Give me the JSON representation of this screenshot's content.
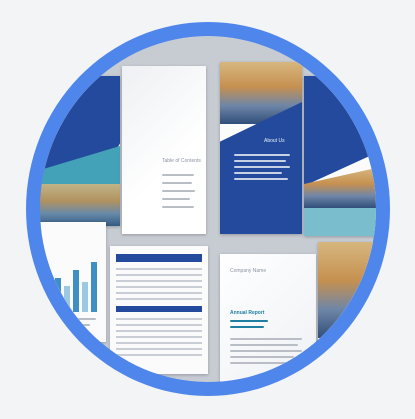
{
  "image": {
    "description_colors": {
      "background": "#f3f4f6",
      "ring": "#4f86ec",
      "navy": "#234a9d",
      "teal": "#43a2b8"
    }
  },
  "spreads": {
    "top_left": {
      "page_title": "Table of Contents"
    },
    "top_right": {
      "heading": "About Us"
    },
    "bottom_right": {
      "cover_title": "Company Name",
      "headline": "Annual Report"
    }
  }
}
